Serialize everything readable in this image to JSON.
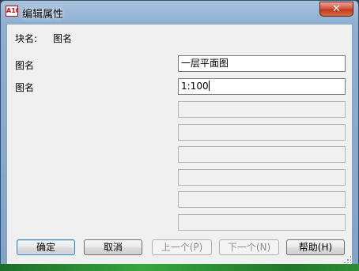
{
  "window": {
    "title": "编辑属性",
    "app_icon_text": "A10",
    "close_glyph": "✕"
  },
  "block": {
    "label": "块名:",
    "value": "图名"
  },
  "attributes": [
    {
      "label": "图名",
      "value": "一层平面图"
    },
    {
      "label": "图名",
      "value": "1:100"
    }
  ],
  "buttons": {
    "ok": "确定",
    "cancel": "取消",
    "prev": "上一个(P)",
    "next": "下一个(N)",
    "help": "帮助(H)"
  }
}
